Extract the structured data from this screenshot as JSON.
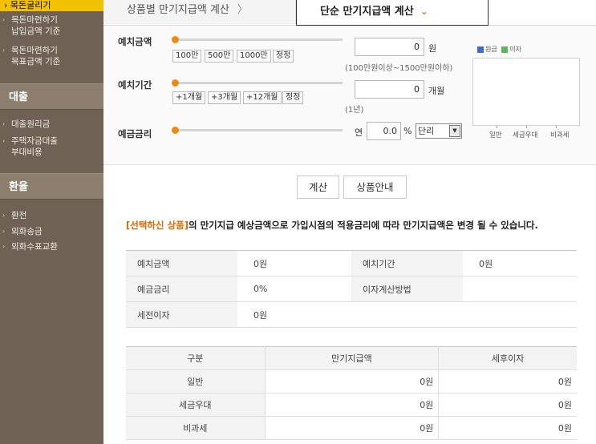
{
  "sidebar": {
    "active_item": "목돈굴리기",
    "group1": [
      {
        "line1": "목돈마련하기",
        "line2": "납입금액 기준"
      },
      {
        "line1": "목돈마련하기",
        "line2": "목표금액 기준"
      }
    ],
    "section_loan": "대출",
    "loan_items": [
      {
        "line1": "대출원리금",
        "line2": ""
      },
      {
        "line1": "주택자금대출",
        "line2": "부대비용"
      }
    ],
    "section_fx": "환율",
    "fx_items": [
      "환전",
      "외화송금",
      "외화수표교환"
    ]
  },
  "tabs": {
    "tab1": "상품별 만기지급액 계산",
    "tab1_chevron": "〉",
    "tab2": "단순 만기지급액 계산",
    "tab2_chevron": "⌄"
  },
  "form": {
    "deposit": {
      "label": "예치금액",
      "chips": [
        "100만",
        "500만",
        "1000만",
        "정정"
      ],
      "value": "0",
      "unit": "원",
      "hint": "(100만원이상~1500만원이하)",
      "slider_level": 0
    },
    "period": {
      "label": "예치기간",
      "chips": [
        "+1개월",
        "+3개월",
        "+12개월",
        "정정"
      ],
      "value": "0",
      "unit": "개월",
      "hint": "(1년)",
      "slider_level": 0
    },
    "rate": {
      "label": "예금금리",
      "prefix": "연",
      "value": "0.0",
      "unit": "%",
      "method_selected": "단리",
      "slider_level": 0
    }
  },
  "chart_data": {
    "type": "bar",
    "categories": [
      "일반",
      "세금우대",
      "비과세"
    ],
    "series": [
      {
        "name": "원금",
        "values": [
          0,
          0,
          0
        ]
      },
      {
        "name": "이자",
        "values": [
          0,
          0,
          0
        ]
      }
    ],
    "title": "",
    "xlabel": "",
    "ylabel": ""
  },
  "colors": {
    "principal": "#3d6fc7",
    "interest": "#5cb85c",
    "accent": "#f0890f",
    "active": "#f2c200"
  },
  "actions": {
    "calc": "계산",
    "product_info": "상품안내"
  },
  "notice": {
    "highlight": "[선택하신 상품]",
    "text": "의 만기지급 예상금액으로 가입시점의 적용금리에 따라 만기지급액은 변경 될 수 있습니다."
  },
  "summary": {
    "rows": [
      [
        {
          "k": "예치금액",
          "v": "0원"
        },
        {
          "k": "예치기간",
          "v": "0원"
        }
      ],
      [
        {
          "k": "예금금리",
          "v": "0%"
        },
        {
          "k": "이자계산방법",
          "v": ""
        }
      ],
      [
        {
          "k": "세전이자",
          "v": "0원"
        }
      ]
    ]
  },
  "results": {
    "headers": [
      "구분",
      "만기지급액",
      "세후이자"
    ],
    "rows": [
      [
        "일반",
        "0원",
        "0원"
      ],
      [
        "세금우대",
        "0원",
        "0원"
      ],
      [
        "비과세",
        "0원",
        "0원"
      ]
    ]
  }
}
